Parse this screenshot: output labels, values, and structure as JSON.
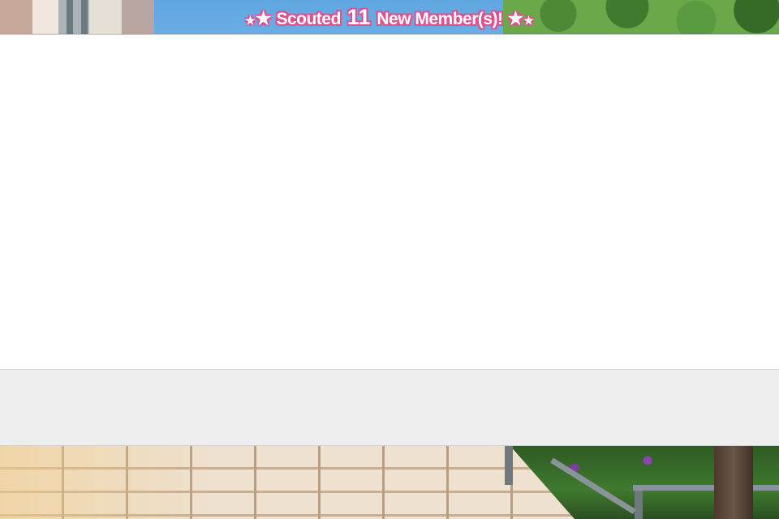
{
  "banner": {
    "prefix": "Scouted",
    "count": "11",
    "suffix": "New Member(s)!",
    "accent_color": "#e0508f",
    "left_icon": "stars-icon",
    "right_icon": "stars-icon"
  },
  "results_panel": {
    "background": "#ffffff"
  },
  "footer_panel": {
    "background": "#eeeeee"
  }
}
